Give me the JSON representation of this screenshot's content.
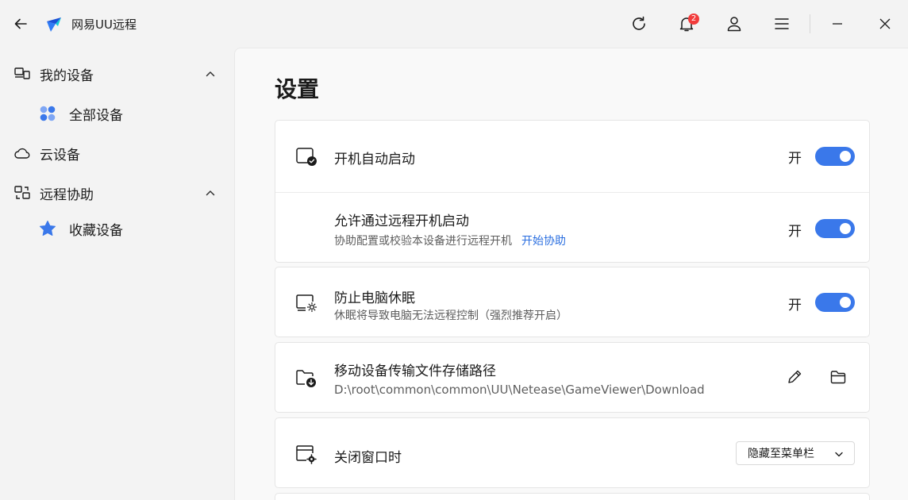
{
  "app": {
    "title": "网易UU远程"
  },
  "titlebar": {
    "notification_count": "2"
  },
  "sidebar": {
    "items": [
      {
        "label": "我的设备",
        "icon": "devices-icon",
        "expanded": true
      },
      {
        "label": "全部设备",
        "icon": "grid-dots-icon"
      },
      {
        "label": "云设备",
        "icon": "cloud-icon"
      },
      {
        "label": "远程协助",
        "icon": "remote-assist-icon",
        "expanded": true
      },
      {
        "label": "收藏设备",
        "icon": "star-icon"
      }
    ]
  },
  "main": {
    "title": "设置",
    "settings": {
      "autostart": {
        "title": "开机自动启动",
        "state": "开",
        "on": true
      },
      "wake_remote": {
        "title": "允许通过远程开机启动",
        "subtitle": "协助配置或校验本设备进行远程开机",
        "link": "开始协助",
        "state": "开",
        "on": true
      },
      "prevent_sleep": {
        "title": "防止电脑休眠",
        "subtitle": "休眠将导致电脑无法远程控制（强烈推荐开启）",
        "state": "开",
        "on": true
      },
      "transfer_path": {
        "title": "移动设备传输文件存储路径",
        "path": "D:\\root\\common\\common\\UU\\Netease\\GameViewer\\Download"
      },
      "close_window": {
        "title": "关闭窗口时",
        "selected": "隐藏至菜单栏"
      }
    }
  },
  "colors": {
    "accent": "#3a78ea",
    "badge": "#f23b3b",
    "link": "#2b6fe0"
  }
}
